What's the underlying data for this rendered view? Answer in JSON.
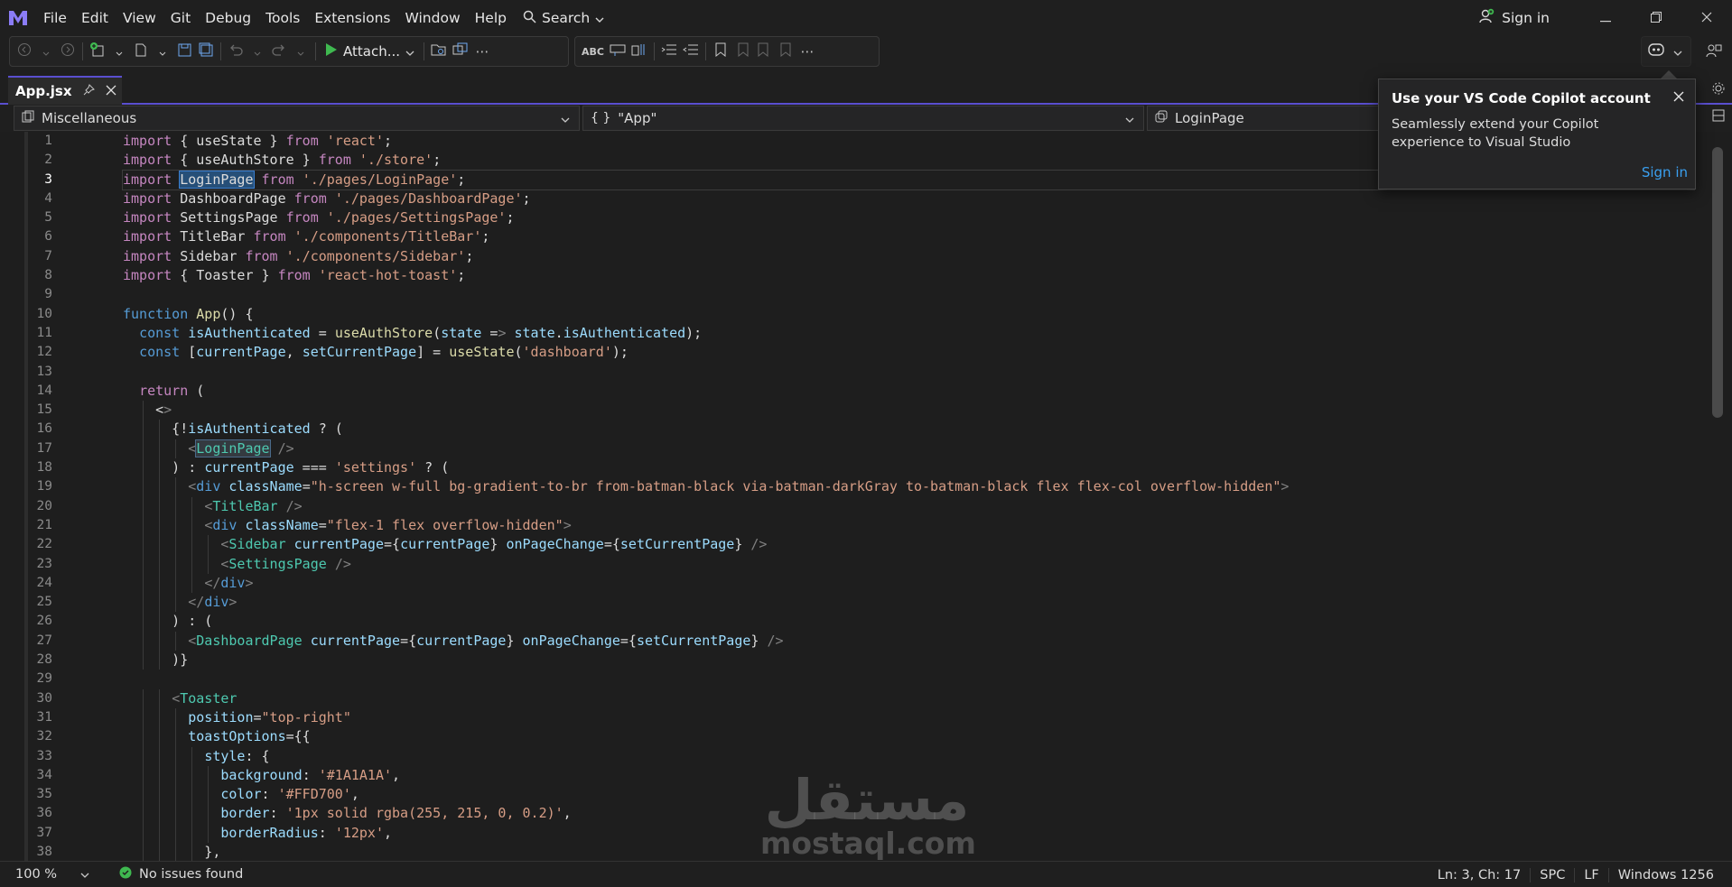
{
  "menubar": {
    "items": [
      "File",
      "Edit",
      "View",
      "Git",
      "Debug",
      "Tools",
      "Extensions",
      "Window",
      "Help"
    ],
    "search_label": "Search",
    "signin_label": "Sign in"
  },
  "toolbar": {
    "attach_label": "Attach..."
  },
  "tab": {
    "title": "App.jsx"
  },
  "navbar": {
    "project": "Miscellaneous",
    "scope": "\"App\"",
    "member": "LoginPage"
  },
  "editor": {
    "current_line": 3,
    "line_numbers": [
      "1",
      "2",
      "3",
      "4",
      "5",
      "6",
      "7",
      "8",
      "9",
      "10",
      "11",
      "12",
      "13",
      "14",
      "15",
      "16",
      "17",
      "18",
      "19",
      "20",
      "21",
      "22",
      "23",
      "24",
      "25",
      "26",
      "27",
      "28",
      "29",
      "30",
      "31",
      "32",
      "33",
      "34",
      "35",
      "36",
      "37",
      "38"
    ],
    "lines": [
      "import { useState } from 'react';",
      "import { useAuthStore } from './store';",
      "import LoginPage from './pages/LoginPage';",
      "import DashboardPage from './pages/DashboardPage';",
      "import SettingsPage from './pages/SettingsPage';",
      "import TitleBar from './components/TitleBar';",
      "import Sidebar from './components/Sidebar';",
      "import { Toaster } from 'react-hot-toast';",
      "",
      "function App() {",
      "  const isAuthenticated = useAuthStore(state => state.isAuthenticated);",
      "  const [currentPage, setCurrentPage] = useState('dashboard');",
      "",
      "  return (",
      "    <>",
      "      {!isAuthenticated ? (",
      "        <LoginPage />",
      "      ) : currentPage === 'settings' ? (",
      "        <div className=\"h-screen w-full bg-gradient-to-br from-batman-black via-batman-darkGray to-batman-black flex flex-col overflow-hidden\">",
      "          <TitleBar />",
      "          <div className=\"flex-1 flex overflow-hidden\">",
      "            <Sidebar currentPage={currentPage} onPageChange={setCurrentPage} />",
      "            <SettingsPage />",
      "          </div>",
      "        </div>",
      "      ) : (",
      "        <DashboardPage currentPage={currentPage} onPageChange={setCurrentPage} />",
      "      )}",
      "",
      "      <Toaster",
      "        position=\"top-right\"",
      "        toastOptions={{",
      "          style: {",
      "            background: '#1A1A1A',",
      "            color: '#FFD700',",
      "            border: '1px solid rgba(255, 215, 0, 0.2)',",
      "            borderRadius: '12px',",
      "          },"
    ]
  },
  "popup": {
    "title": "Use your VS Code Copilot account",
    "body": "Seamlessly extend your Copilot experience to Visual Studio",
    "link": "Sign in"
  },
  "watermark": {
    "arabic": "مستقل",
    "latin": "mostaql.com"
  },
  "statusbar": {
    "zoom": "100 %",
    "issues": "No issues found",
    "position": "Ln: 3, Ch: 17",
    "indent": "SPC",
    "line_ending": "LF",
    "encoding": "Windows 1256"
  },
  "colors": {
    "accent": "#5a4fcf",
    "link": "#3aa0f0",
    "success": "#3fb950",
    "keyword": "#569cd6",
    "string": "#d69d85",
    "component": "#4ec9b0"
  },
  "icons": {
    "logo": "visual-studio-logo",
    "search": "search-icon",
    "account": "account-add-icon",
    "copilot": "copilot-icon"
  }
}
